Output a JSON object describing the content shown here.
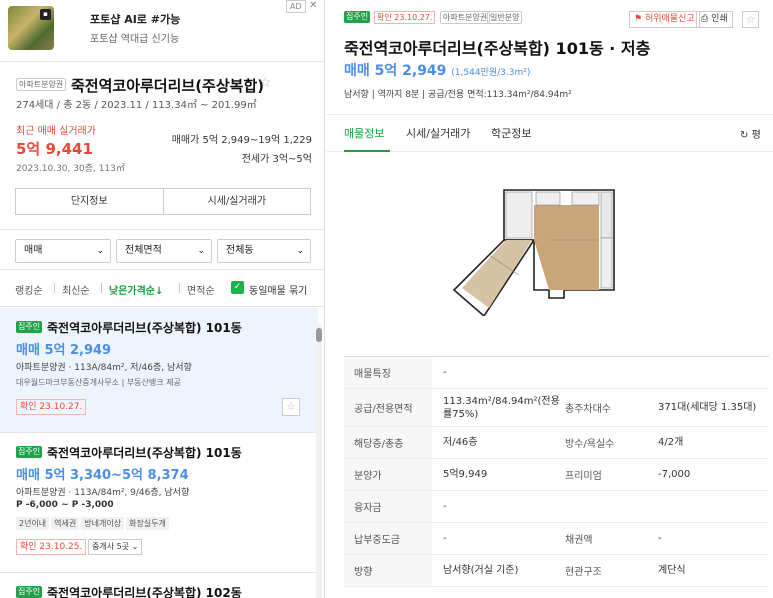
{
  "ad": {
    "badge": "AD",
    "title": "포토샵 AI로 #가능",
    "subtitle": "포토샵 역대급 신기능"
  },
  "complex": {
    "tag": "아파트분양권",
    "name": "죽전역코아루더리브(주상복합)",
    "info": "274세대 / 총 2동 / 2023.11 / 113.34㎡ ~ 201.99㎡",
    "recent_label": "최근 매매 실거래가",
    "recent_price": "5억 9,441",
    "recent_detail": "2023.10.30, 30층, 113㎡",
    "sale_range": "매매가 5억 2,949~19억 1,229",
    "jeonse_range": "전세가 3억~5억",
    "btn_info": "단지정보",
    "btn_trade": "시세/실거래가"
  },
  "filters": {
    "deal": "매매",
    "area": "전체면적",
    "dong": "전체동"
  },
  "sort": {
    "rank": "랭킹순",
    "newest": "최신순",
    "low_price": "낮은가격순↓",
    "area": "면적순",
    "group": "동일매물 묶기"
  },
  "listings": [
    {
      "tag": "집주인",
      "name": "죽전역코아루더리브(주상복합) 101동",
      "price": "매매 5억 2,949",
      "desc": "아파트분양권 · 113A/84m², 저/46층, 남서향",
      "agent": "대우월드마크부동산중개사무소 | 부동산뱅크 제공",
      "confirm": "확인 23.10.27."
    },
    {
      "tag": "집주인",
      "name": "죽전역코아루더리브(주상복합) 101동",
      "price": "매매 5억 3,340~5억 8,374",
      "desc": "아파트분양권 · 113A/84m², 9/46층, 남서향",
      "premium": "P -6,000 ~ P -3,000",
      "chips": [
        "2년이내",
        "역세권",
        "방네개이상",
        "화장실두개"
      ],
      "confirm": "확인 23.10.25.",
      "agents": "중개사 5곳 ⌄"
    },
    {
      "tag": "집주인",
      "name": "죽전역코아루더리브(주상복합) 102동"
    }
  ],
  "detail": {
    "tag": "집주인",
    "confirm": "확인 23.10.27.",
    "type1": "아파트분양권",
    "type2": "일반분양",
    "report": "허위매물신고",
    "print": "인쇄",
    "title": "죽전역코아루더리브(주상복합) 101동 · 저층",
    "price": "매매 5억 2,949",
    "price_unit": "(1,544만원/3.3m²)",
    "summary": "남서향 | 역까지 8분 | 공급/전용 면적:113.34m²/84.94m²",
    "tabs": [
      "매물정보",
      "시세/실거래가",
      "학군정보"
    ],
    "refresh": "평",
    "rows": [
      {
        "k1": "매물특징",
        "v1": "-"
      },
      {
        "k1": "공급/전용면적",
        "v1": "113.34m²/84.94m²(전용률75%)",
        "k2": "총주차대수",
        "v2": "371대(세대당 1.35대)"
      },
      {
        "k1": "해당층/총층",
        "v1": "저/46층",
        "k2": "방수/욕실수",
        "v2": "4/2개"
      },
      {
        "k1": "분양가",
        "v1": "5억9,949",
        "k2": "프리미엄",
        "v2": "-7,000"
      },
      {
        "k1": "융자금",
        "v1": "-"
      },
      {
        "k1": "납부중도금",
        "v1": "-",
        "k2": "채권액",
        "v2": "-"
      },
      {
        "k1": "방향",
        "v1": "남서향(거실 기준)",
        "k2": "현관구조",
        "v2": "계단식"
      }
    ]
  },
  "colors": {
    "green": "#21a24a",
    "blue": "#4a8fe7",
    "red": "#e84a3a"
  }
}
